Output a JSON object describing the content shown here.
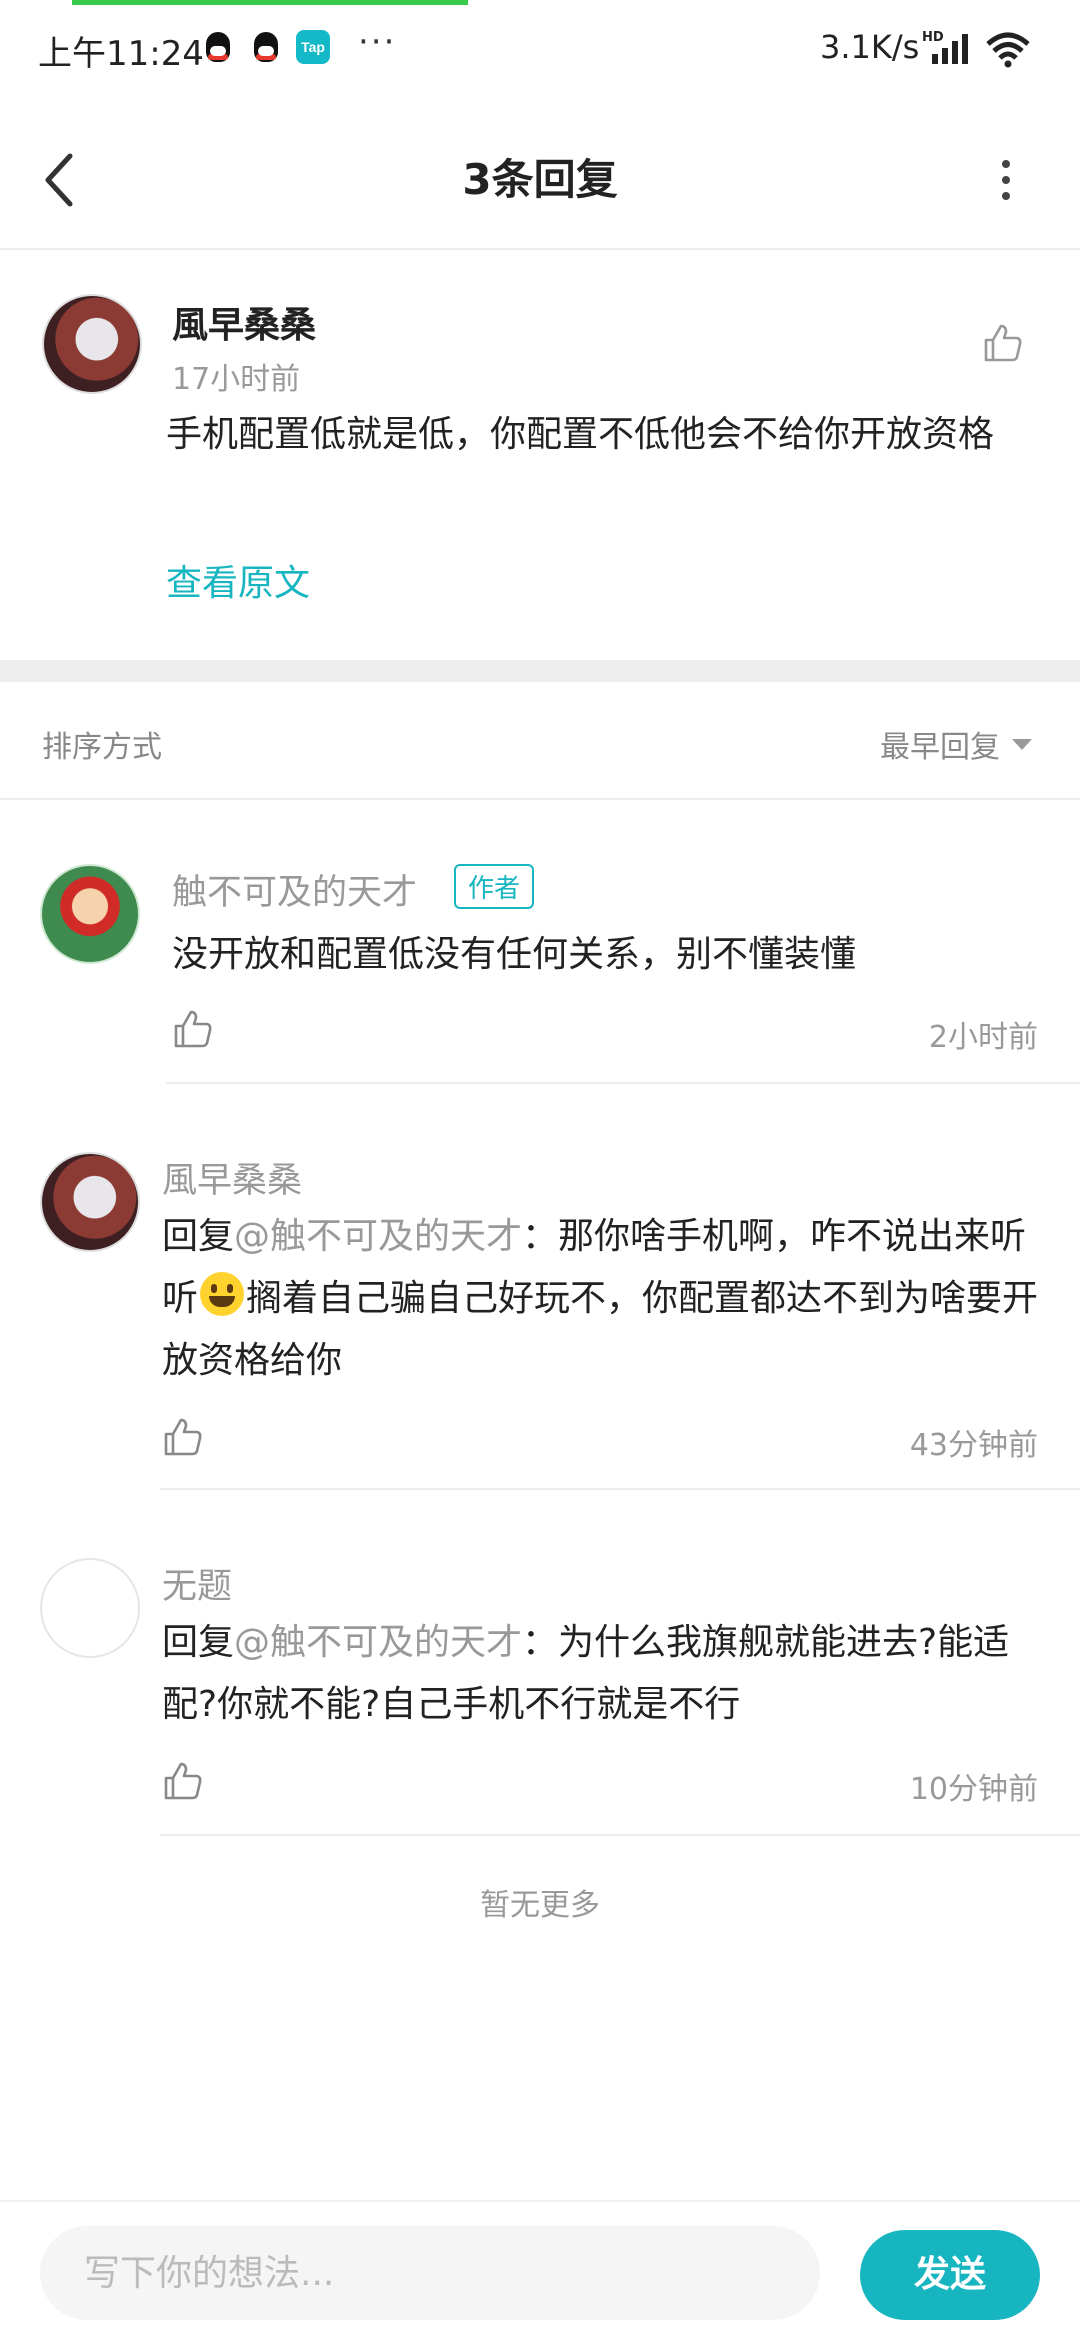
{
  "status_bar": {
    "time": "上午11:24",
    "tap_label": "Tap",
    "more": "···",
    "net_speed": "3.1K/s",
    "hd": "HD"
  },
  "header": {
    "title": "3条回复"
  },
  "original_comment": {
    "author": "風早桑桑",
    "time": "17小时前",
    "content": "手机配置低就是低，你配置不低他会不给你开放资格",
    "view_original": "查看原文"
  },
  "sort": {
    "label": "排序方式",
    "selected": "最早回复"
  },
  "replies": [
    {
      "author": "触不可及的天才",
      "badge": "作者",
      "content": "没开放和配置低没有任何关系，别不懂装懂",
      "time": "2小时前"
    },
    {
      "author": "風早桑桑",
      "reply_prefix": "回复",
      "mention": "@触不可及的天才",
      "content_before_emoji": "：那你啥手机啊，咋不说出来听听",
      "emoji": "grinning-face",
      "content_after_emoji": "搁着自己骗自己好玩不，你配置都达不到为啥要开放资格给你",
      "time": "43分钟前"
    },
    {
      "author": "无题",
      "reply_prefix": "回复",
      "mention": "@触不可及的天才",
      "content": "：为什么我旗舰就能进去?能适配?你就不能?自己手机不行就是不行",
      "time": "10分钟前"
    }
  ],
  "no_more": "暂无更多",
  "input": {
    "placeholder": "写下你的想法..."
  },
  "send_label": "发送",
  "colors": {
    "accent": "#17b5c0",
    "progress": "#36c94a"
  }
}
